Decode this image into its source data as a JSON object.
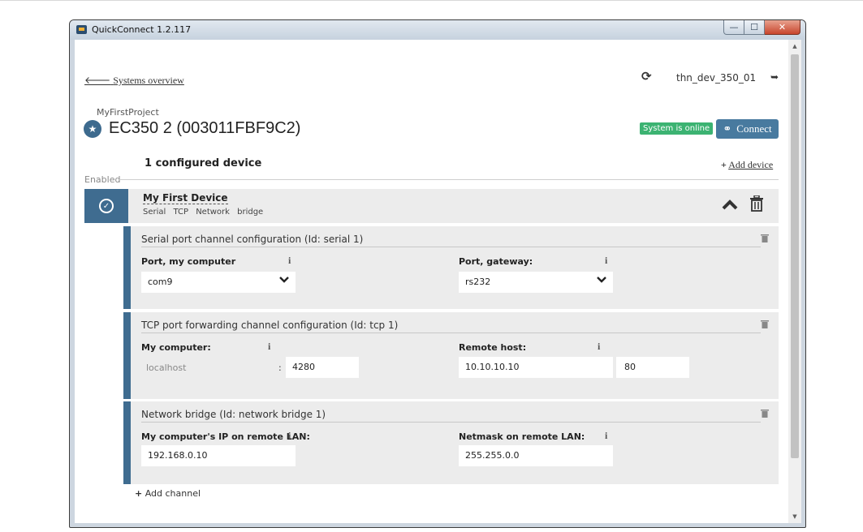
{
  "window": {
    "title": "QuickConnect 1.2.117",
    "minimize": "—",
    "maximize": "☐",
    "close": "✕"
  },
  "header": {
    "back_arrow": "🡐",
    "back_label": "Systems overview",
    "refresh_glyph": "⟳",
    "username": "thn_dev_350_01",
    "logout_glyph": "➥"
  },
  "system": {
    "project": "MyFirstProject",
    "star_glyph": "★",
    "title": "EC350 2 (003011FBF9C2)",
    "status": "System is online",
    "connect_glyph": "⚭",
    "connect_label": "Connect"
  },
  "devices_section": {
    "heading": "1 configured device",
    "add_device_plus": "+",
    "add_device_label": "Add device",
    "enabled_label": "Enabled"
  },
  "device": {
    "name": "My First Device",
    "tags": "Serial TCP Network bridge",
    "check_glyph": "✓",
    "collapse_glyph": "︿"
  },
  "channels": [
    {
      "title": "Serial port channel configuration (Id: serial 1)",
      "left_label": "Port, my computer",
      "left_value": "com9",
      "right_label": "Port, gateway:",
      "right_value": "rs232"
    },
    {
      "title": "TCP port forwarding channel configuration (Id: tcp 1)",
      "left_label": "My computer:",
      "left_host": "localhost",
      "left_port": "4280",
      "right_label": "Remote host:",
      "right_host": "10.10.10.10",
      "right_port": "80"
    },
    {
      "title": "Network bridge (Id: network bridge 1)",
      "left_label": "My computer's IP on remote LAN:",
      "left_value": "192.168.0.10",
      "right_label": "Netmask on remote LAN:",
      "right_value": "255.255.0.0"
    }
  ],
  "common": {
    "info": "i",
    "colon": ":",
    "chevron": "⌄"
  },
  "add_channel": {
    "plus": "+",
    "label": "Add channel"
  },
  "colors": {
    "accent": "#3f6c90",
    "online": "#3cb372",
    "close": "#c8452c"
  }
}
